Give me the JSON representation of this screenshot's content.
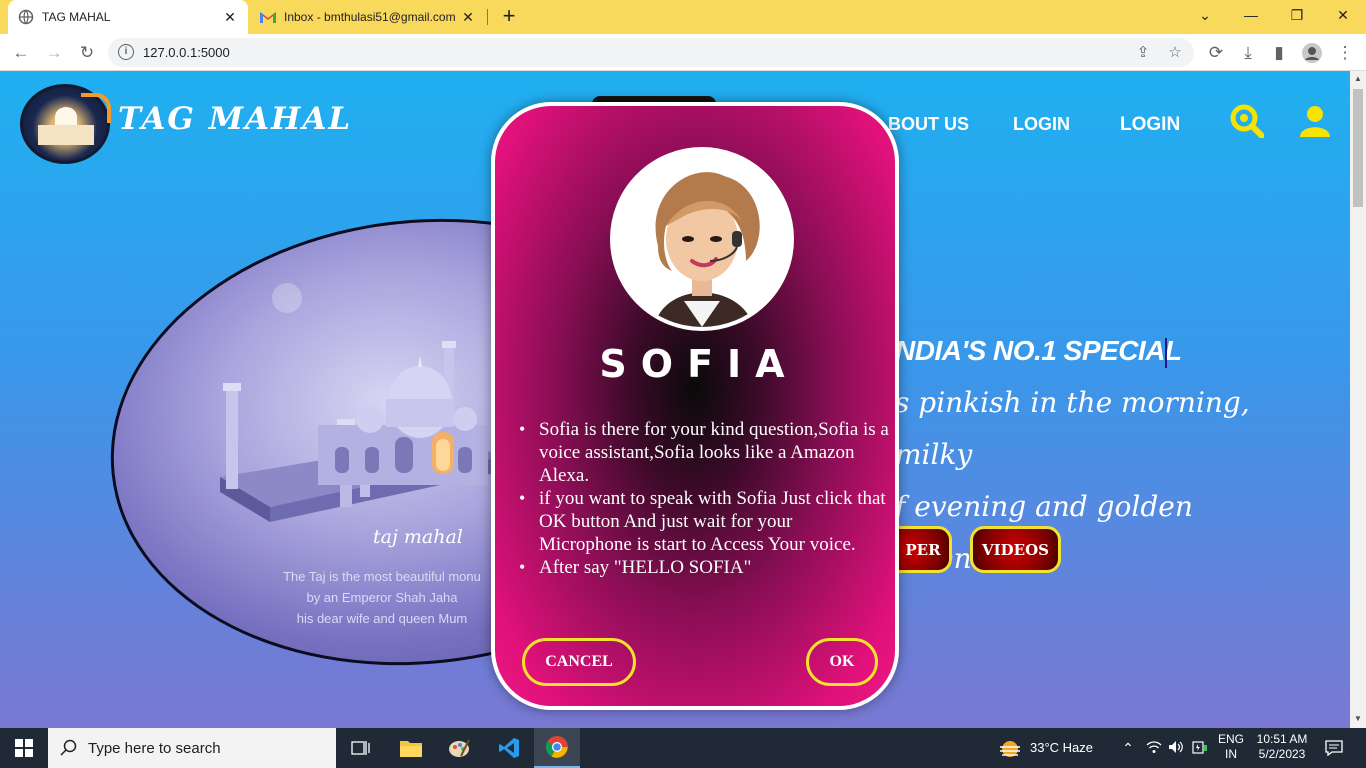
{
  "browser": {
    "tabs": [
      {
        "title": "TAG MAHAL",
        "active": true
      },
      {
        "title": "Inbox - bmthulasi51@gmail.com",
        "active": false
      }
    ],
    "url": "127.0.0.1:5000"
  },
  "site": {
    "title": "TAG MAHAL",
    "nav": [
      "BOUT US",
      "LOGIN",
      "LOGIN"
    ],
    "headline": "NDIA'S NO.1 SPECIAL",
    "tagline_line1": "s pinkish in the morning, milky",
    "tagline_line2": "f evening and golden when moon",
    "card": {
      "caption": "taj mahal",
      "desc_line1": "The Taj is the most beautiful monu",
      "desc_line2": "by an Emperor Shah Jaha",
      "desc_line3": "his dear wife and queen Mum"
    },
    "buttons": {
      "paper": "PER",
      "videos": "VIDEOS"
    }
  },
  "modal": {
    "title": "SOFIA",
    "items": [
      "Sofia is there for your kind question,Sofia is a voice assistant,Sofia looks like a Amazon Alexa.",
      "if you want to speak with Sofia Just click that OK button And just wait for your Microphone is start to Access Your voice.",
      "After say \"HELLO SOFIA\""
    ],
    "cancel": "CANCEL",
    "ok": "OK"
  },
  "taskbar": {
    "search_placeholder": "Type here to search",
    "weather": "33°C  Haze",
    "lang_line1": "ENG",
    "lang_line2": "IN",
    "time": "10:51 AM",
    "date": "5/2/2023"
  },
  "colors": {
    "tabstrip": "#f9d95b",
    "modal_pink": "#ec1882",
    "button_border": "#f3e22c",
    "accent_yellow": "#f5e400"
  }
}
